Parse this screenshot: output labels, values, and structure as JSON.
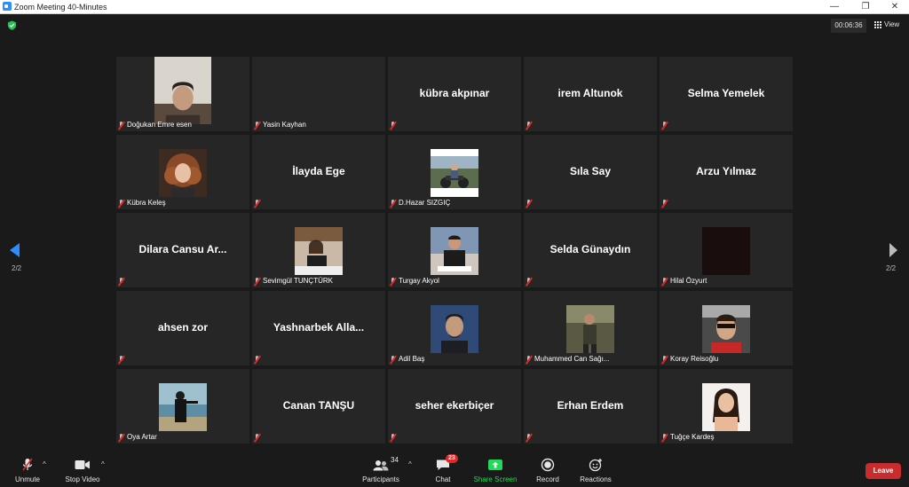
{
  "window": {
    "title": "Zoom Meeting 40-Minutes",
    "minimize": "—",
    "restore": "❐",
    "close": "✕"
  },
  "header": {
    "timer": "00:06:36",
    "view_label": "View"
  },
  "pagination": {
    "left": "2/2",
    "right": "2/2"
  },
  "participants_tiles": [
    {
      "name": "Doğukan Emre esen",
      "display": "",
      "video": "man-face"
    },
    {
      "name": "Yasin Kayhan",
      "display": "",
      "video": "blank"
    },
    {
      "name": "",
      "display": "kübra akpınar",
      "video": "none"
    },
    {
      "name": "",
      "display": "irem Altunok",
      "video": "none"
    },
    {
      "name": "",
      "display": "Selma Yemelek",
      "video": "none"
    },
    {
      "name": "Kübra Keleş",
      "display": "",
      "video": "woman-curly"
    },
    {
      "name": "",
      "display": "İlayda Ege",
      "video": "none"
    },
    {
      "name": "D.Hazar SIZGIÇ",
      "display": "",
      "video": "motorcycle"
    },
    {
      "name": "",
      "display": "Sıla Say",
      "video": "none"
    },
    {
      "name": "",
      "display": "Arzu Yılmaz",
      "video": "none"
    },
    {
      "name": "",
      "display": "Dilara Cansu Ar...",
      "video": "none"
    },
    {
      "name": "Sevimgül TUNÇTÜRK",
      "display": "",
      "video": "woman-table"
    },
    {
      "name": "Turgay Akyol",
      "display": "",
      "video": "man-sitting"
    },
    {
      "name": "",
      "display": "Selda Günaydın",
      "video": "none"
    },
    {
      "name": "Hilal Özyurt",
      "display": "",
      "video": "dark"
    },
    {
      "name": "",
      "display": "ahsen zor",
      "video": "none"
    },
    {
      "name": "",
      "display": "Yashnarbek  Alla...",
      "video": "none"
    },
    {
      "name": "Adil Baş",
      "display": "",
      "video": "man-portrait"
    },
    {
      "name": "Muhammed Can Sağı...",
      "display": "",
      "video": "man-outdoor"
    },
    {
      "name": "Koray Reisoğlu",
      "display": "",
      "video": "man-car"
    },
    {
      "name": "Oya Artar",
      "display": "",
      "video": "woman-beach"
    },
    {
      "name": "",
      "display": "Canan TANŞU",
      "video": "none"
    },
    {
      "name": "",
      "display": "seher ekerbiçer",
      "video": "none"
    },
    {
      "name": "",
      "display": "Erhan Erdem",
      "video": "none"
    },
    {
      "name": "Tuğçe Kardeş",
      "display": "",
      "video": "woman-selfie"
    }
  ],
  "toolbar": {
    "unmute": "Unmute",
    "stop_video": "Stop Video",
    "participants": "Participants",
    "participants_count": "34",
    "chat": "Chat",
    "chat_badge": "23",
    "share_screen": "Share Screen",
    "record": "Record",
    "reactions": "Reactions",
    "leave": "Leave"
  },
  "colors": {
    "accent": "#2d8cff",
    "share_green": "#23d959",
    "leave_red": "#c92c2c",
    "tile_bg": "#262626"
  }
}
